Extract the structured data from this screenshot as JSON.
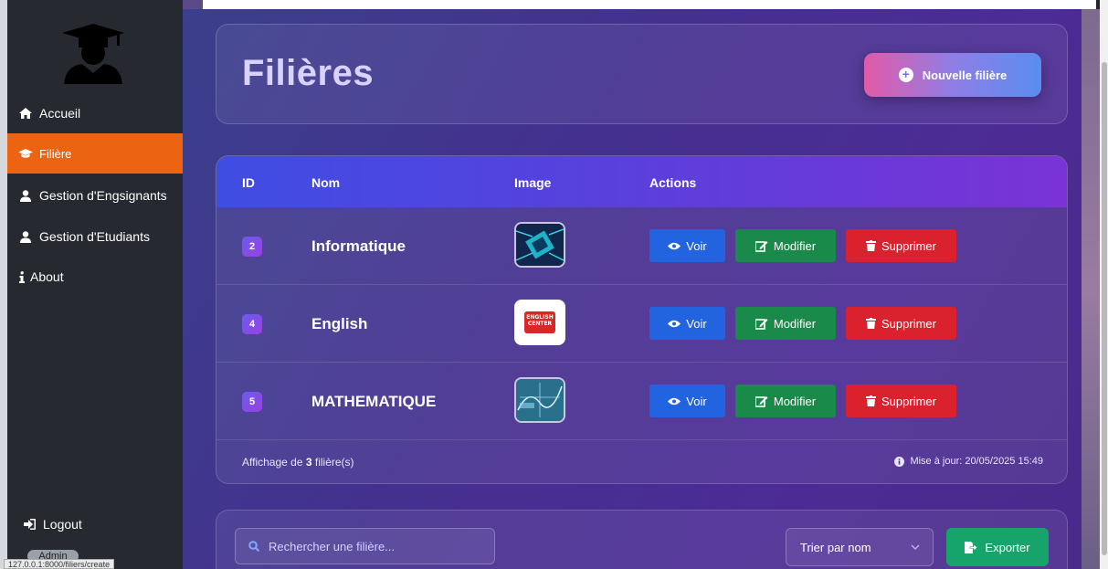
{
  "sidebar": {
    "items": [
      {
        "label": "Accueil",
        "icon": "home-icon"
      },
      {
        "label": "Filière",
        "icon": "graduation-cap-icon"
      },
      {
        "label": "Gestion d'Engsignants",
        "icon": "user-icon"
      },
      {
        "label": "Gestion d'Etudiants",
        "icon": "user-icon"
      },
      {
        "label": "About",
        "icon": "info-icon"
      }
    ],
    "logout": "Logout",
    "admin": "Admin",
    "status_url": "127.0.0.1:8000/filiers/create"
  },
  "header": {
    "title": "Filières",
    "new_button": "Nouvelle filière"
  },
  "table": {
    "columns": [
      "ID",
      "Nom",
      "Image",
      "Actions"
    ],
    "rows": [
      {
        "id": "2",
        "name": "Informatique",
        "image": "circuit-image"
      },
      {
        "id": "4",
        "name": "English",
        "image": "english-center-logo",
        "image_text_1": "ENGLISH",
        "image_text_2": "CENTER"
      },
      {
        "id": "5",
        "name": "MATHEMATIQUE",
        "image": "math-board-image"
      }
    ],
    "actions": {
      "view": "Voir",
      "edit": "Modifier",
      "delete": "Supprimer"
    },
    "footer_prefix": "Affichage de ",
    "footer_count": "3",
    "footer_suffix": " filière(s)",
    "updated": "Mise à jour: 20/05/2025 15:49"
  },
  "toolbar": {
    "search_placeholder": "Rechercher une filière...",
    "sort_label": "Trier par nom",
    "export_label": "Exporter"
  },
  "colors": {
    "active_nav": "#ec6411",
    "view": "#2263e0",
    "edit": "#198a4a",
    "delete": "#d9222d",
    "export": "#17a46a"
  }
}
